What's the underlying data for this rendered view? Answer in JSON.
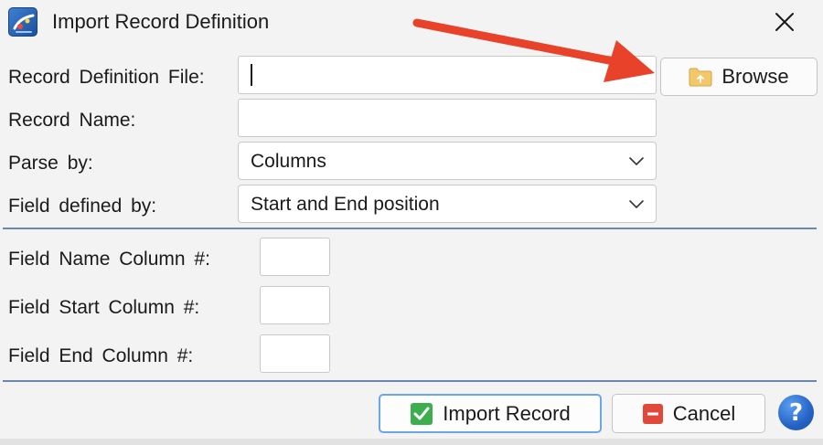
{
  "window": {
    "title": "Import Record Definition",
    "icon": "app-logo-icon",
    "close_icon": "close-icon"
  },
  "form": {
    "record_definition_file": {
      "label": "Record  Definition  File:",
      "value": ""
    },
    "browse_button": {
      "label": "Browse",
      "icon": "folder-icon"
    },
    "record_name": {
      "label": "Record  Name:",
      "value": ""
    },
    "parse_by": {
      "label": "Parse by:",
      "selected": "Columns"
    },
    "field_defined_by": {
      "label": "Field defined by:",
      "selected": "Start and End position"
    },
    "field_name_column": {
      "label": "Field  Name  Column #:",
      "value": ""
    },
    "field_start_column": {
      "label": "Field Start Column #:",
      "value": ""
    },
    "field_end_column": {
      "label": "Field End Column #:",
      "value": ""
    }
  },
  "footer": {
    "import_button": {
      "label": "Import Record",
      "icon": "checkmark-icon"
    },
    "cancel_button": {
      "label": "Cancel",
      "icon": "minus-icon"
    },
    "help_button": {
      "label": "?",
      "icon": "help-icon"
    }
  },
  "annotation": {
    "icon": "red-arrow-icon",
    "color": "#e8432a"
  }
}
